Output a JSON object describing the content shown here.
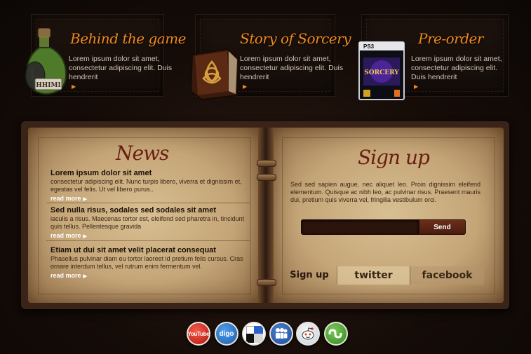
{
  "features": [
    {
      "title": "Behind the game",
      "text": "Lorem ipsum dolor sit amet, consectetur adipiscing elit. Duis hendrerit",
      "icon": "potion-bottle-icon",
      "bottle_label": "HHIMI"
    },
    {
      "title": "Story of Sorcery",
      "text": "Lorem ipsum dolor sit amet, consectetur adipiscing elit. Duis hendrerit",
      "icon": "spellbook-icon"
    },
    {
      "title": "Pre-order",
      "text": "Lorem ipsum dolor sit amet, consectetur adipiscing elit. Duis hendrerit",
      "icon": "game-box-icon",
      "box_label": "SORCERY",
      "box_platform": "PS3"
    }
  ],
  "news": {
    "title": "News",
    "items": [
      {
        "headline": "Lorem ipsum dolor sit amet",
        "text": "consectetur adipiscing elit. Nunc turpis libero, viverra et dignissim et, egestas vel felis. Ut vel libero purus..",
        "more": "read more"
      },
      {
        "headline": "Sed nulla risus, sodales sed sodales sit amet",
        "text": "iaculis a risus. Maecenas tortor est, eleifend sed pharetra in, tincidunt quis tellus. Pellentesque gravida",
        "more": "read more"
      },
      {
        "headline": "Etiam ut dui sit amet velit placerat consequat",
        "text": "Phasellus pulvinar diam eu tortor laoreet id pretium felis cursus. Cras ornare interdum tellus, vel rutrum enim fermentum vel.",
        "more": "read more"
      }
    ]
  },
  "signup": {
    "title": "Sign up",
    "text": "Sed sed sapien augue, nec aliquet leo. Proin dignissim eleifend elementum. Quisque ac nibh leo, ac pulvinar risus. Praesent mauris dui, pretium quis viverra vel, fringilla vestibulum orci.",
    "input_value": "",
    "button": "Send",
    "tabs": [
      "Sign up",
      "twitter",
      "facebook"
    ]
  },
  "social": {
    "youtube": "YouTube",
    "diigo": "digo",
    "delicious": "delicious-icon",
    "myspace": "myspace-icon",
    "reddit": "reddit-icon",
    "stumbleupon": "stumbleupon-icon"
  },
  "colors": {
    "accent_orange": "#f08a1e",
    "title_red": "#6a1e12",
    "parchment": "#c4a577",
    "background": "#150c08"
  }
}
